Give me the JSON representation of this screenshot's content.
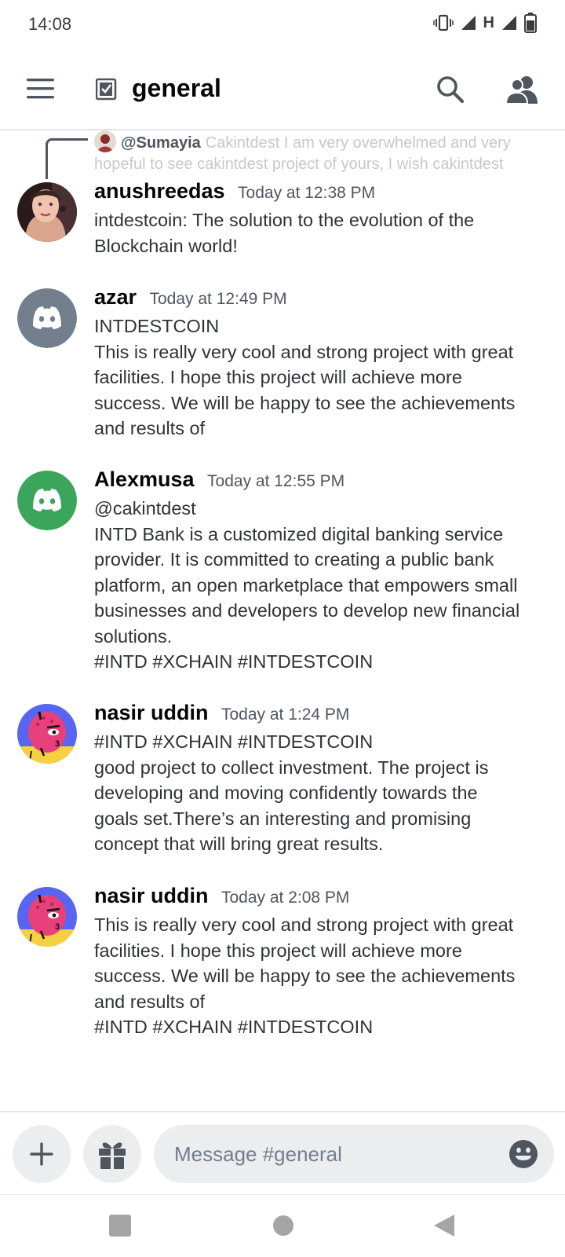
{
  "status": {
    "time": "14:08",
    "network_label": "H"
  },
  "header": {
    "channel_name": "general",
    "menu_icon": "hamburger-menu-icon",
    "channel_icon": "text-channel-icon",
    "search_icon": "search-icon",
    "members_icon": "members-icon"
  },
  "reply": {
    "user": "@Sumayia",
    "text_line1": "Cakintdest I am very overwhelmed and very",
    "text_line2": "hopeful to see cakintdest project of yours, I wish cakintdest"
  },
  "messages": [
    {
      "username": "anushreedas",
      "timestamp": "Today at 12:38 PM",
      "lines": [
        "intdestcoin: The solution to the evolution of the",
        "Blockchain world!"
      ]
    },
    {
      "username": "azar",
      "timestamp": "Today at 12:49 PM",
      "lines": [
        "INTDESTCOIN",
        "This is really very cool and strong project with great",
        "facilities. I hope this project will achieve more",
        "success. We will be happy to see the achievements",
        "and results of"
      ]
    },
    {
      "username": "Alexmusa",
      "timestamp": "Today at 12:55 PM",
      "lines": [
        "@cakintdest",
        "INTD Bank is a customized digital banking service",
        "provider. It is committed to creating a public bank",
        "platform, an open marketplace that empowers small",
        "businesses and developers to develop new financial",
        "solutions.",
        "#INTD #XCHAIN   #INTDESTCOIN"
      ]
    },
    {
      "username": "nasir uddin",
      "timestamp": "Today at 1:24 PM",
      "lines": [
        "#INTD #XCHAIN   #INTDESTCOIN",
        "good project to collect investment. The project is",
        "developing and moving confidently towards the",
        "goals set.There’s an interesting and promising",
        "concept that will bring great results."
      ]
    },
    {
      "username": "nasir uddin",
      "timestamp": "Today at 2:08 PM",
      "lines": [
        "This is really very cool and strong project with great",
        "facilities. I hope this project will achieve more",
        "success. We will be happy to see the achievements",
        "and results of",
        "#INTD #XCHAIN   #INTDESTCOIN"
      ]
    }
  ],
  "composer": {
    "placeholder": "Message #general",
    "add_icon": "plus-icon",
    "gift_icon": "gift-icon",
    "emoji_icon": "emoji-icon"
  },
  "colors": {
    "discord_gray": "#747f8d",
    "discord_green": "#3ba55c",
    "blurple": "#5865f2"
  }
}
